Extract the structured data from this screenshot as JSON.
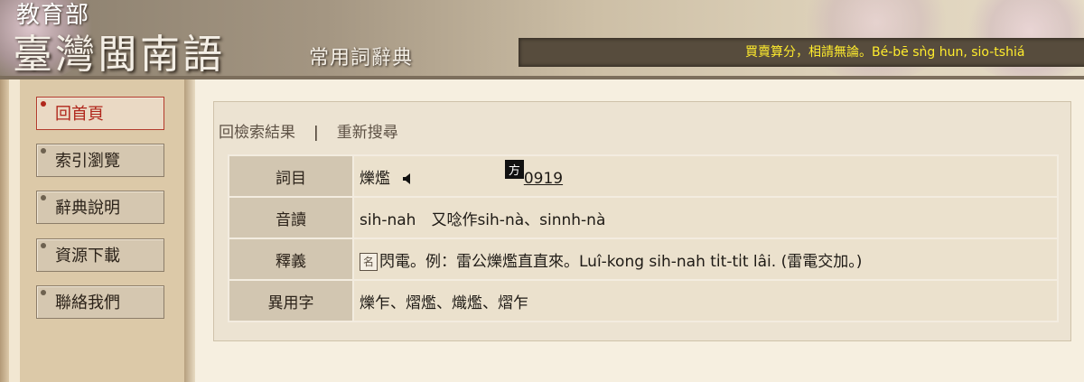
{
  "header": {
    "ministry": "教育部",
    "title": "臺灣閩南語",
    "subtitle": "常用詞辭典",
    "marquee": "買賣算分，相請無論。Bé-bē sǹg hun, sio-tshiá"
  },
  "sidebar": {
    "items": [
      {
        "label": "回首頁"
      },
      {
        "label": "索引瀏覽"
      },
      {
        "label": "辭典說明"
      },
      {
        "label": "資源下載"
      },
      {
        "label": "聯絡我們"
      }
    ]
  },
  "panel_nav": {
    "back": "回檢索結果",
    "separator": "|",
    "new_search": "重新搜尋"
  },
  "entry": {
    "headword_label": "詞目",
    "headword": "爍爁",
    "dialect_badge": "方",
    "entry_number": "0919",
    "pronunciation_label": "音讀",
    "pronunciation": "sih-nah　又唸作sih-nà、sinnh-nà",
    "definition_label": "釋義",
    "pos_badge": "名",
    "definition": "閃電。例：雷公爍爁直直來。Luî-kong sih-nah ti̍t-ti̍t lâi. (雷電交加。)",
    "variants_label": "異用字",
    "variants": "爍乍、熠爁、熾爁、熠乍"
  },
  "icons": {
    "speaker": "speaker-icon"
  },
  "colors": {
    "active_nav": "#b0261b",
    "marquee_text": "#ffec2d"
  }
}
